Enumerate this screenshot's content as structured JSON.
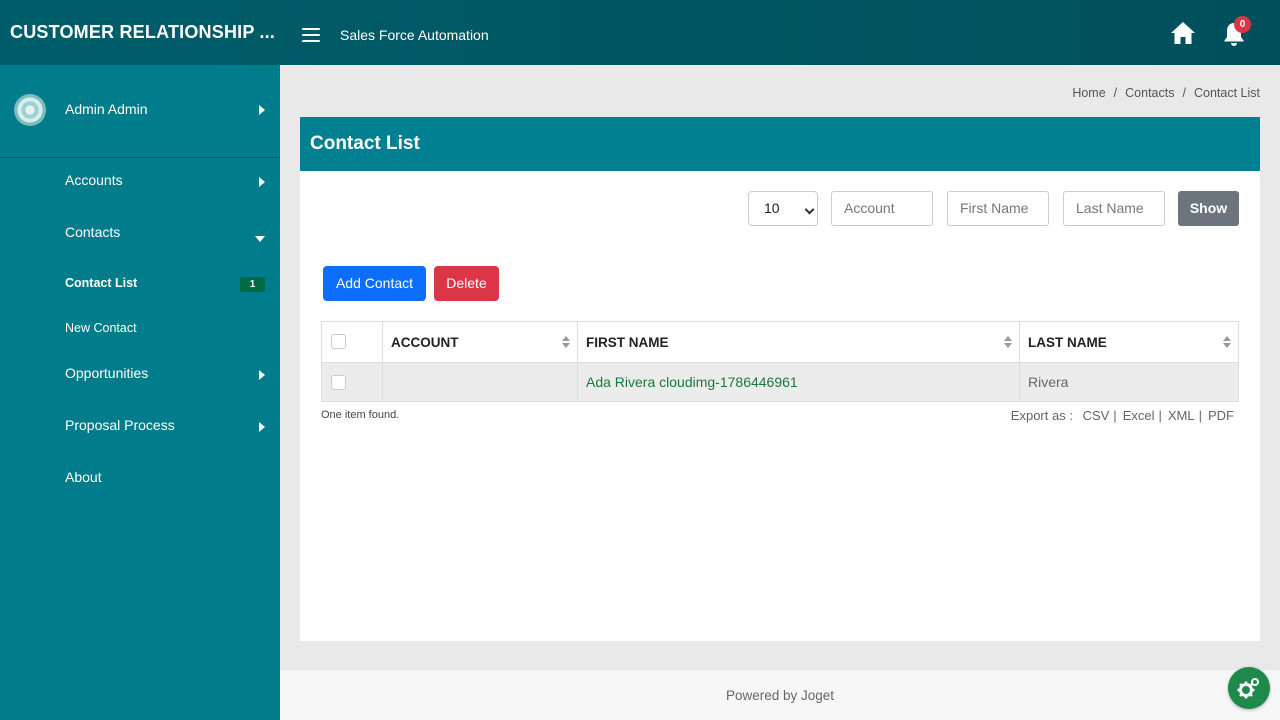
{
  "header": {
    "brand": "CUSTOMER RELATIONSHIP ...",
    "app_title": "Sales Force Automation",
    "notification_count": "0"
  },
  "sidebar": {
    "user_name": "Admin Admin",
    "items": [
      {
        "label": "Accounts"
      },
      {
        "label": "Contacts"
      },
      {
        "label": "Opportunities"
      },
      {
        "label": "Proposal Process"
      },
      {
        "label": "About"
      }
    ],
    "contacts_sub": [
      {
        "label": "Contact List",
        "count": "1"
      },
      {
        "label": "New Contact"
      }
    ]
  },
  "breadcrumb": [
    "Home",
    "Contacts",
    "Contact List"
  ],
  "page": {
    "title": "Contact List"
  },
  "filters": {
    "page_size": "10",
    "account_placeholder": "Account",
    "first_name_placeholder": "First Name",
    "last_name_placeholder": "Last Name",
    "show_label": "Show"
  },
  "actions": {
    "add_label": "Add Contact",
    "delete_label": "Delete"
  },
  "table": {
    "columns": [
      "ACCOUNT",
      "FIRST NAME",
      "LAST NAME"
    ],
    "rows": [
      {
        "account": "",
        "first_name": "Ada Rivera cloudimg-1786446961",
        "last_name": "Rivera"
      }
    ],
    "found_text": "One item found.",
    "export_label": "Export as :",
    "export_options": [
      "CSV",
      "Excel",
      "XML",
      "PDF"
    ]
  },
  "footer": {
    "text": "Powered by Joget"
  },
  "colors": {
    "topbar": "#005e6a",
    "sidebar": "#007c8a",
    "card_header": "#008090",
    "primary": "#0d6efd",
    "danger": "#dc3545"
  }
}
